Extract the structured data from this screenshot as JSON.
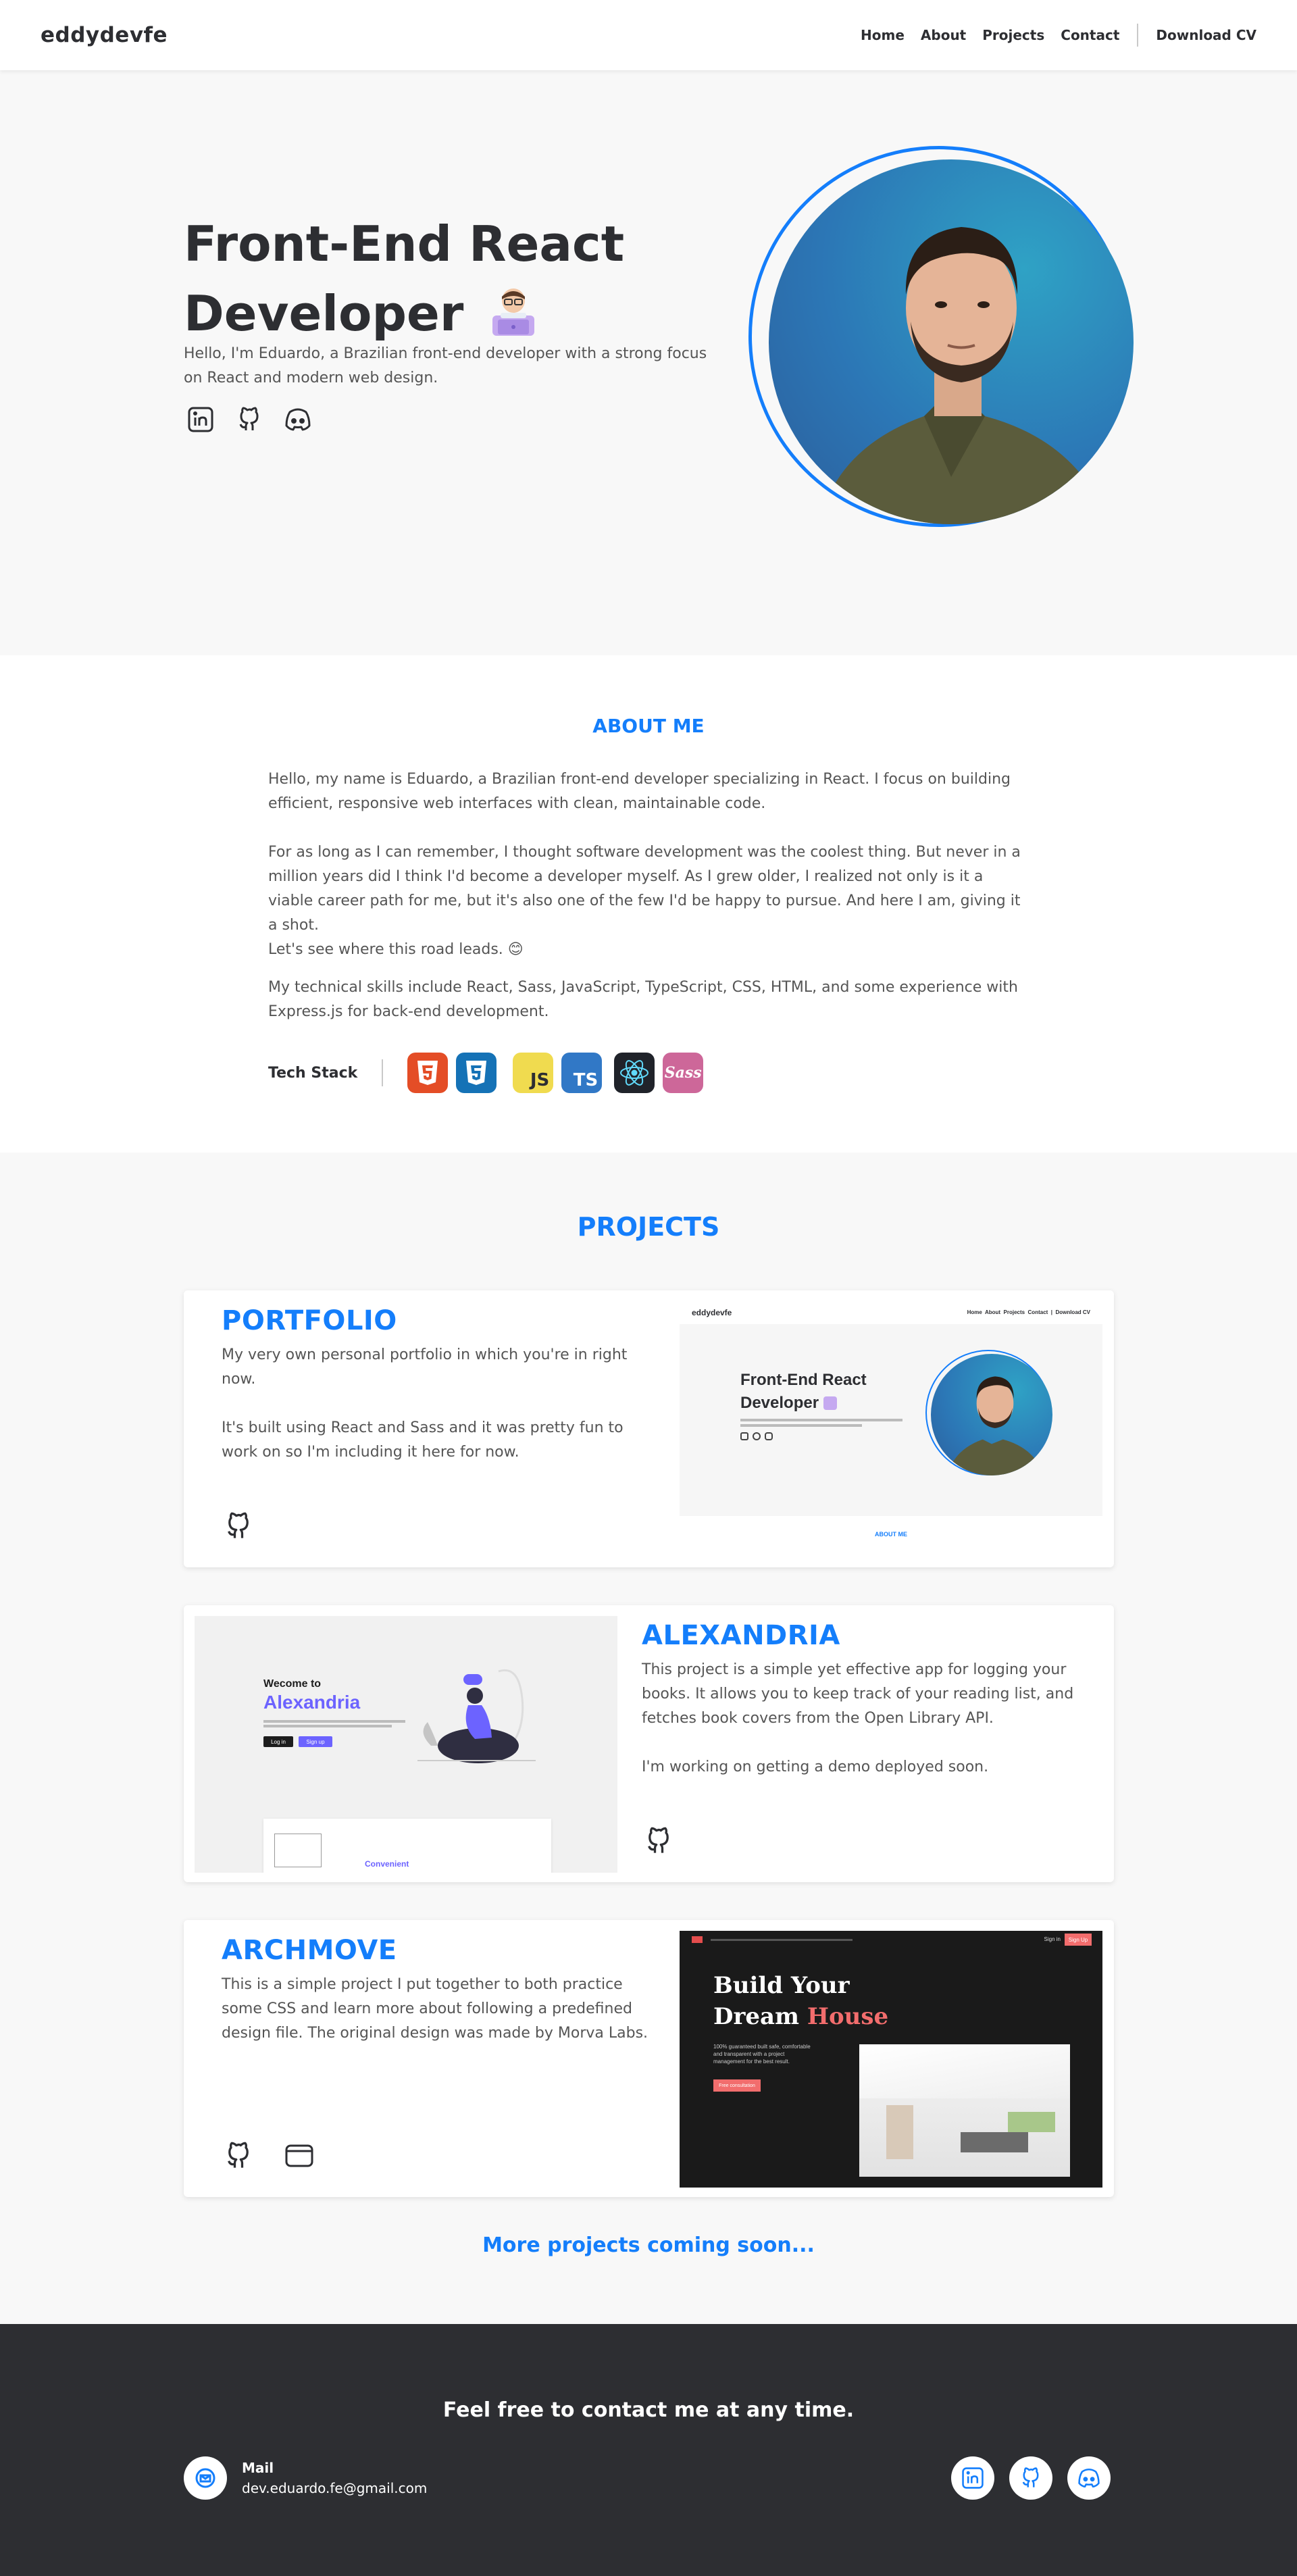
{
  "header": {
    "logo": "eddydevfe",
    "nav": [
      "Home",
      "About",
      "Projects",
      "Contact"
    ],
    "download_cv": "Download CV"
  },
  "hero": {
    "title_line1": "Front-End React",
    "title_line2": "Developer",
    "description": "Hello, I'm Eduardo, a Brazilian front-end developer with a strong focus on React and modern web design."
  },
  "about": {
    "title": "ABOUT ME",
    "p1": "Hello, my name is Eduardo, a Brazilian front-end developer specializing in React. I focus on building efficient, responsive web interfaces with clean, maintainable code.",
    "p2": "For as long as I can remember, I thought software development was the coolest thing. But never in a million years did I think I'd become a developer myself. As I grew older, I realized not only is it a viable career path for me, but it's also one of the few I'd be happy to pursue. And here I am, giving it a shot.",
    "p3": "Let's see where this road leads. 😊",
    "p4": "My technical skills include React, Sass, JavaScript, TypeScript, CSS, HTML, and some experience with Express.js for back-end development.",
    "stack_label": "Tech Stack",
    "stack": [
      "html5-icon",
      "css3-icon",
      "javascript-icon",
      "typescript-icon",
      "react-icon",
      "sass-icon"
    ]
  },
  "projects": {
    "title": "PROJECTS",
    "items": [
      {
        "name": "PORTFOLIO",
        "p1": "My very own personal portfolio in which you're in right now.",
        "p2": "It's built using React and Sass and it was pretty fun to work on so I'm including it here for now."
      },
      {
        "name": "ALEXANDRIA",
        "p1": "This project is a simple yet effective app for logging your books. It allows you to keep track of your reading list, and fetches book covers from the Open Library API.",
        "p2": "I'm working on getting a demo deployed soon."
      },
      {
        "name": "ARCHMOVE",
        "p1": "This is a simple project I put together to both practice some CSS and learn more about following a predefined design file. The original design was made by Morva Labs."
      }
    ],
    "coming_soon": "More projects coming soon..."
  },
  "shots": {
    "portfolio": {
      "logo": "eddydevfe",
      "nav": "Home  About  Projects  Contact  |  Download CV",
      "title1": "Front-End React",
      "title2": "Developer",
      "about": "ABOUT ME"
    },
    "alexandria": {
      "welcome": "Wecome to",
      "name": "Alexandria",
      "login": "Log in",
      "signup": "Sign up",
      "convenient": "Convenient"
    },
    "archmove": {
      "title1": "Build Your",
      "title2a": "Dream ",
      "title2b": "House",
      "text": "100% guaranteed built safe, comfortable and transparent with a project management for the best result.",
      "cta": "Free consultation",
      "signin": "Sign in",
      "signup": "Sign Up"
    }
  },
  "footer": {
    "title": "Feel free to contact me at any time.",
    "mail_label": "Mail",
    "mail_address": "dev.eduardo.fe@gmail.com"
  },
  "colors": {
    "accent": "#147efb",
    "dark": "#2d2e32"
  }
}
